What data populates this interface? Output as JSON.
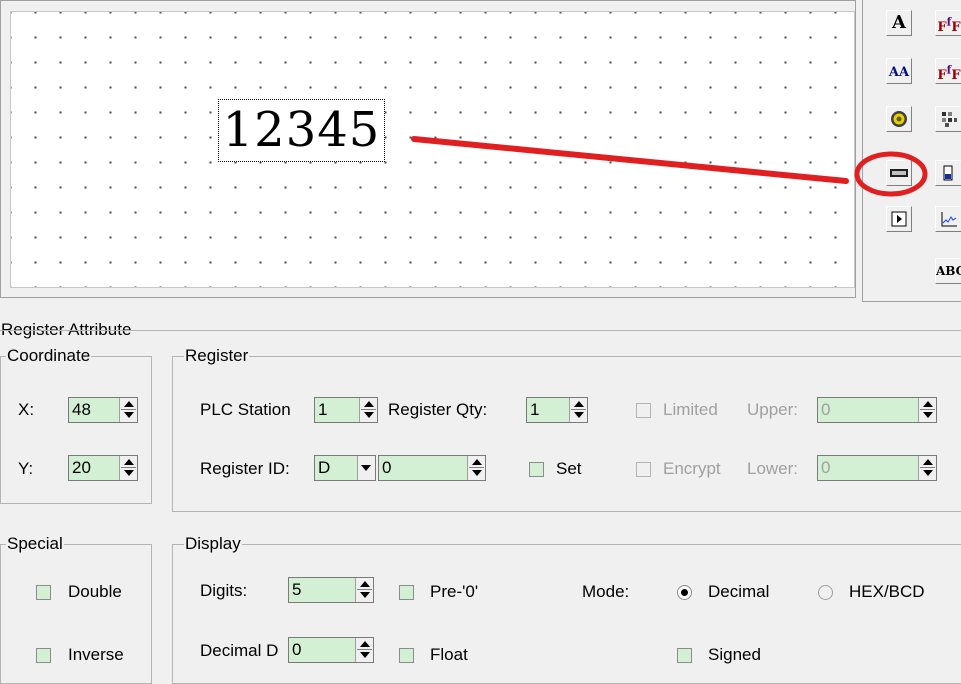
{
  "canvas": {
    "sample_value": "12345"
  },
  "toolbox": {
    "tools": [
      {
        "icon": "text-tool-icon",
        "glyph": "A"
      },
      {
        "icon": "formula-text-tool-icon",
        "glyph": "F"
      },
      {
        "icon": "scaled-text-tool-icon",
        "glyph": "AA"
      },
      {
        "icon": "formula-variable-tool-icon",
        "glyph": "F"
      },
      {
        "icon": "lamp-tool-icon",
        "glyph": ""
      },
      {
        "icon": "matrix-tool-icon",
        "glyph": ""
      },
      {
        "icon": "register-display-tool-icon",
        "glyph": ""
      },
      {
        "icon": "bar-graph-tool-icon",
        "glyph": ""
      },
      {
        "icon": "play-button-tool-icon",
        "glyph": ""
      },
      {
        "icon": "trend-graph-tool-icon",
        "glyph": ""
      },
      {
        "icon": "ascii-tool-icon",
        "glyph": "ABC"
      }
    ],
    "highlight_color": "#e02020"
  },
  "register_attribute": {
    "title": "Register Attribute",
    "coordinate": {
      "title": "Coordinate",
      "x_label": "X:",
      "x_value": "48",
      "y_label": "Y:",
      "y_value": "20"
    },
    "register": {
      "title": "Register",
      "plc_station_label": "PLC Station",
      "plc_station_value": "1",
      "register_qty_label": "Register Qty:",
      "register_qty_value": "1",
      "limited_label": "Limited",
      "upper_label": "Upper:",
      "upper_value": "0",
      "register_id_label": "Register ID:",
      "register_type": "D",
      "register_id_value": "0",
      "set_label": "Set",
      "encrypt_label": "Encrypt",
      "lower_label": "Lower:",
      "lower_value": "0"
    },
    "special": {
      "title": "Special",
      "double_label": "Double",
      "inverse_label": "Inverse"
    },
    "display": {
      "title": "Display",
      "digits_label": "Digits:",
      "digits_value": "5",
      "pre_zero_label": "Pre-'0'",
      "mode_label": "Mode:",
      "decimal_label": "Decimal",
      "hex_bcd_label": "HEX/BCD",
      "decimal_digits_label": "Decimal D",
      "decimal_digits_value": "0",
      "float_label": "Float",
      "signed_label": "Signed",
      "mode_selected": "Decimal"
    }
  },
  "colors": {
    "field_bg": "#d4f0d4",
    "annotation_red": "#e02020"
  }
}
